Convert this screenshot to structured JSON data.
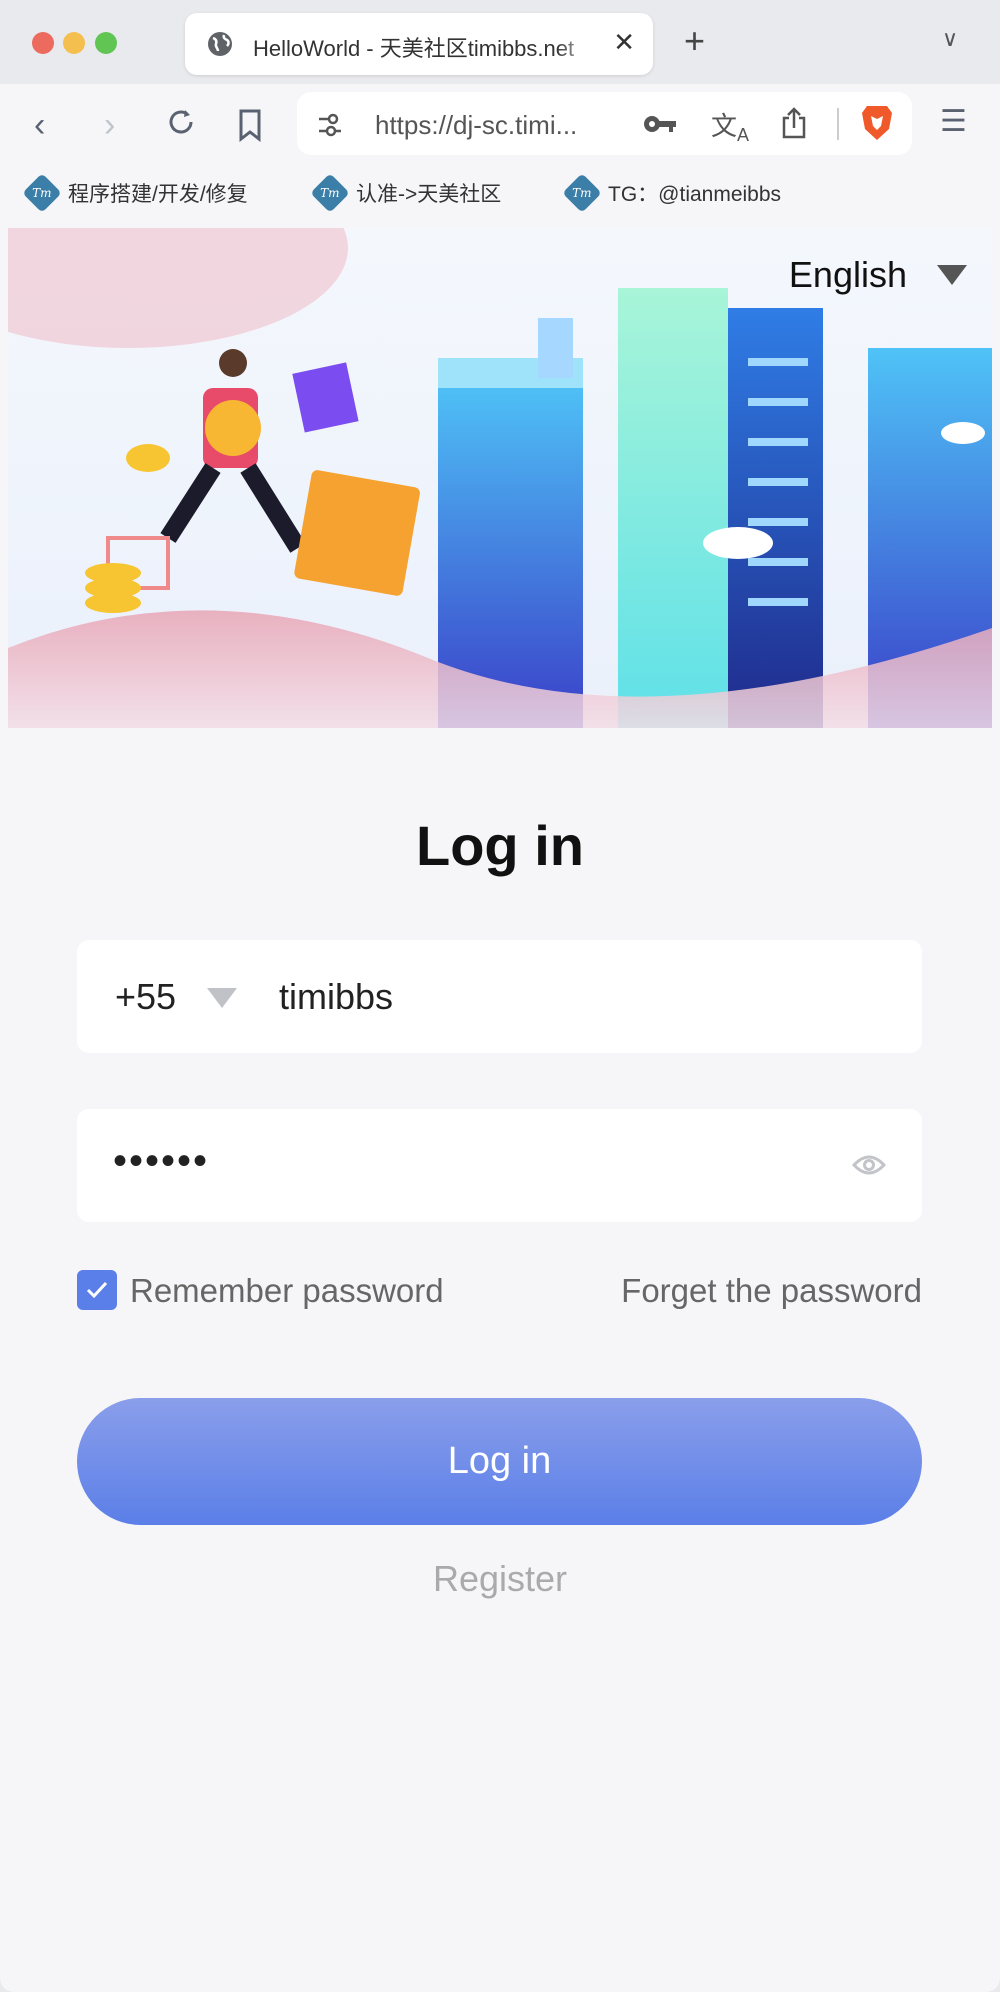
{
  "browser": {
    "tab_title": "HelloWorld - 天美社区timibbs.net",
    "url": "https://dj-sc.timi...",
    "bookmarks": [
      {
        "label": "程序搭建/开发/修复",
        "icon": "Tm"
      },
      {
        "label": "认准->天美社区",
        "icon": "Tm"
      },
      {
        "label": "TG：@tianmeibbs",
        "icon": "Tm"
      }
    ]
  },
  "page": {
    "language": "English",
    "title": "Log in",
    "country_code": "+55",
    "username": "timibbs",
    "password_masked": "••••••",
    "remember_label": "Remember password",
    "remember_checked": true,
    "forget_label": "Forget the password",
    "login_label": "Log in",
    "register_label": "Register",
    "accent_color": "#5b7fe8"
  }
}
